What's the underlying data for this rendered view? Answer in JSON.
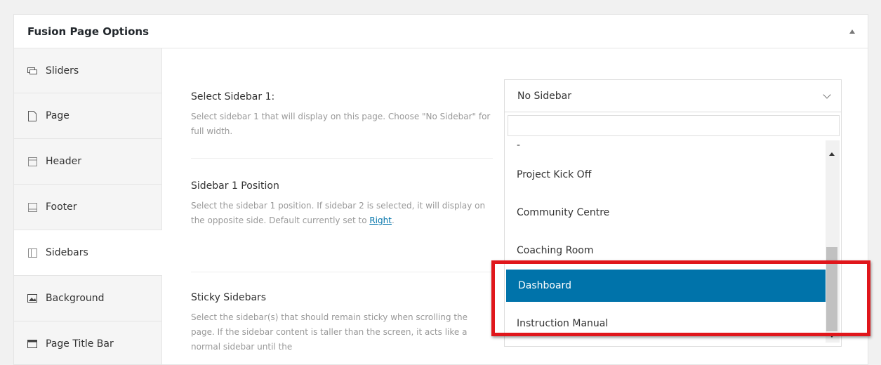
{
  "metabox": {
    "title": "Fusion Page Options"
  },
  "tabs": [
    {
      "label": "Sliders",
      "icon": "sliders-icon"
    },
    {
      "label": "Page",
      "icon": "page-icon"
    },
    {
      "label": "Header",
      "icon": "header-icon"
    },
    {
      "label": "Footer",
      "icon": "footer-icon"
    },
    {
      "label": "Sidebars",
      "icon": "sidebars-icon",
      "active": true
    },
    {
      "label": "Background",
      "icon": "background-icon"
    },
    {
      "label": "Page Title Bar",
      "icon": "page-title-bar-icon"
    }
  ],
  "fields": {
    "sidebar1": {
      "title": "Select Sidebar 1:",
      "desc": "Select sidebar 1 that will display on this page. Choose \"No Sidebar\" for full width."
    },
    "position": {
      "title": "Sidebar 1 Position",
      "desc_prefix": "Select the sidebar 1 position. If sidebar 2 is selected, it will display on the opposite side. Default currently set to ",
      "link": "Right",
      "desc_suffix": "."
    },
    "sticky": {
      "title": "Sticky Sidebars",
      "desc": "Select the sidebar(s) that should remain sticky when scrolling the page. If the sidebar content is taller than the screen, it acts like a normal sidebar until the"
    }
  },
  "select": {
    "value": "No Sidebar"
  },
  "dropdown": {
    "partial_top": "-",
    "items": [
      "Project Kick Off",
      "Community Centre",
      "Coaching Room",
      "Dashboard",
      "Instruction Manual"
    ],
    "highlighted": "Dashboard"
  },
  "colors": {
    "accent": "#0073aa",
    "highlight_box": "#e0161b"
  }
}
